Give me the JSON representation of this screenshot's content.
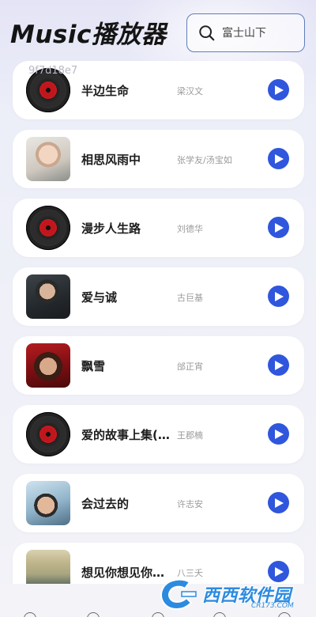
{
  "header": {
    "title": "Music播放器"
  },
  "search": {
    "placeholder": "富士山下",
    "value": ""
  },
  "overlay_id": "9f7d18e7",
  "songs": [
    {
      "title": "半边生命",
      "artist": "梁汉文",
      "cover": "vinyl"
    },
    {
      "title": "相思风雨中",
      "artist": "张学友/汤宝如",
      "cover": "photo-1"
    },
    {
      "title": "漫步人生路",
      "artist": "刘德华",
      "cover": "vinyl"
    },
    {
      "title": "爱与诚",
      "artist": "古巨基",
      "cover": "photo-2"
    },
    {
      "title": "飘雪",
      "artist": "邰正宵",
      "cover": "photo-3"
    },
    {
      "title": "爱的故事上集(…",
      "artist": "王郡楠",
      "cover": "vinyl"
    },
    {
      "title": "会过去的",
      "artist": "许志安",
      "cover": "photo-4"
    },
    {
      "title": "想见你想见你…",
      "artist": "八三夭",
      "cover": "photo-5"
    }
  ],
  "watermark": {
    "text": "西西软件园",
    "url": "CR173.COM"
  },
  "colors": {
    "accent": "#2f56dc",
    "search_border": "#5f7db8",
    "title_text": "#141414",
    "artist_text": "#9a9a9a",
    "card_bg": "#ffffff"
  }
}
